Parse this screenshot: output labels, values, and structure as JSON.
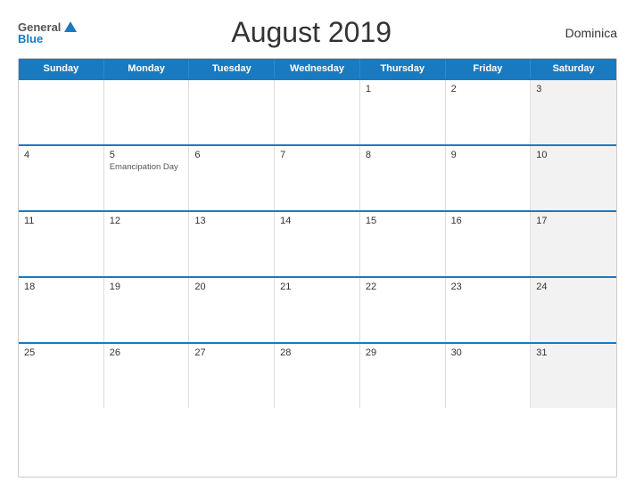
{
  "logo": {
    "general": "General",
    "blue": "Blue",
    "triangle": "▲"
  },
  "title": "August 2019",
  "country": "Dominica",
  "header_days": [
    "Sunday",
    "Monday",
    "Tuesday",
    "Wednesday",
    "Thursday",
    "Friday",
    "Saturday"
  ],
  "weeks": [
    [
      {
        "day": "",
        "holiday": "",
        "gray": false
      },
      {
        "day": "",
        "holiday": "",
        "gray": false
      },
      {
        "day": "",
        "holiday": "",
        "gray": false
      },
      {
        "day": "",
        "holiday": "",
        "gray": false
      },
      {
        "day": "1",
        "holiday": "",
        "gray": false
      },
      {
        "day": "2",
        "holiday": "",
        "gray": false
      },
      {
        "day": "3",
        "holiday": "",
        "gray": true
      }
    ],
    [
      {
        "day": "4",
        "holiday": "",
        "gray": false
      },
      {
        "day": "5",
        "holiday": "Emancipation Day",
        "gray": false
      },
      {
        "day": "6",
        "holiday": "",
        "gray": false
      },
      {
        "day": "7",
        "holiday": "",
        "gray": false
      },
      {
        "day": "8",
        "holiday": "",
        "gray": false
      },
      {
        "day": "9",
        "holiday": "",
        "gray": false
      },
      {
        "day": "10",
        "holiday": "",
        "gray": true
      }
    ],
    [
      {
        "day": "11",
        "holiday": "",
        "gray": false
      },
      {
        "day": "12",
        "holiday": "",
        "gray": false
      },
      {
        "day": "13",
        "holiday": "",
        "gray": false
      },
      {
        "day": "14",
        "holiday": "",
        "gray": false
      },
      {
        "day": "15",
        "holiday": "",
        "gray": false
      },
      {
        "day": "16",
        "holiday": "",
        "gray": false
      },
      {
        "day": "17",
        "holiday": "",
        "gray": true
      }
    ],
    [
      {
        "day": "18",
        "holiday": "",
        "gray": false
      },
      {
        "day": "19",
        "holiday": "",
        "gray": false
      },
      {
        "day": "20",
        "holiday": "",
        "gray": false
      },
      {
        "day": "21",
        "holiday": "",
        "gray": false
      },
      {
        "day": "22",
        "holiday": "",
        "gray": false
      },
      {
        "day": "23",
        "holiday": "",
        "gray": false
      },
      {
        "day": "24",
        "holiday": "",
        "gray": true
      }
    ],
    [
      {
        "day": "25",
        "holiday": "",
        "gray": false
      },
      {
        "day": "26",
        "holiday": "",
        "gray": false
      },
      {
        "day": "27",
        "holiday": "",
        "gray": false
      },
      {
        "day": "28",
        "holiday": "",
        "gray": false
      },
      {
        "day": "29",
        "holiday": "",
        "gray": false
      },
      {
        "day": "30",
        "holiday": "",
        "gray": false
      },
      {
        "day": "31",
        "holiday": "",
        "gray": true
      }
    ]
  ],
  "colors": {
    "header_bg": "#1a7abf",
    "accent": "#1a7abf",
    "saturday_bg": "#f2f2f2"
  }
}
